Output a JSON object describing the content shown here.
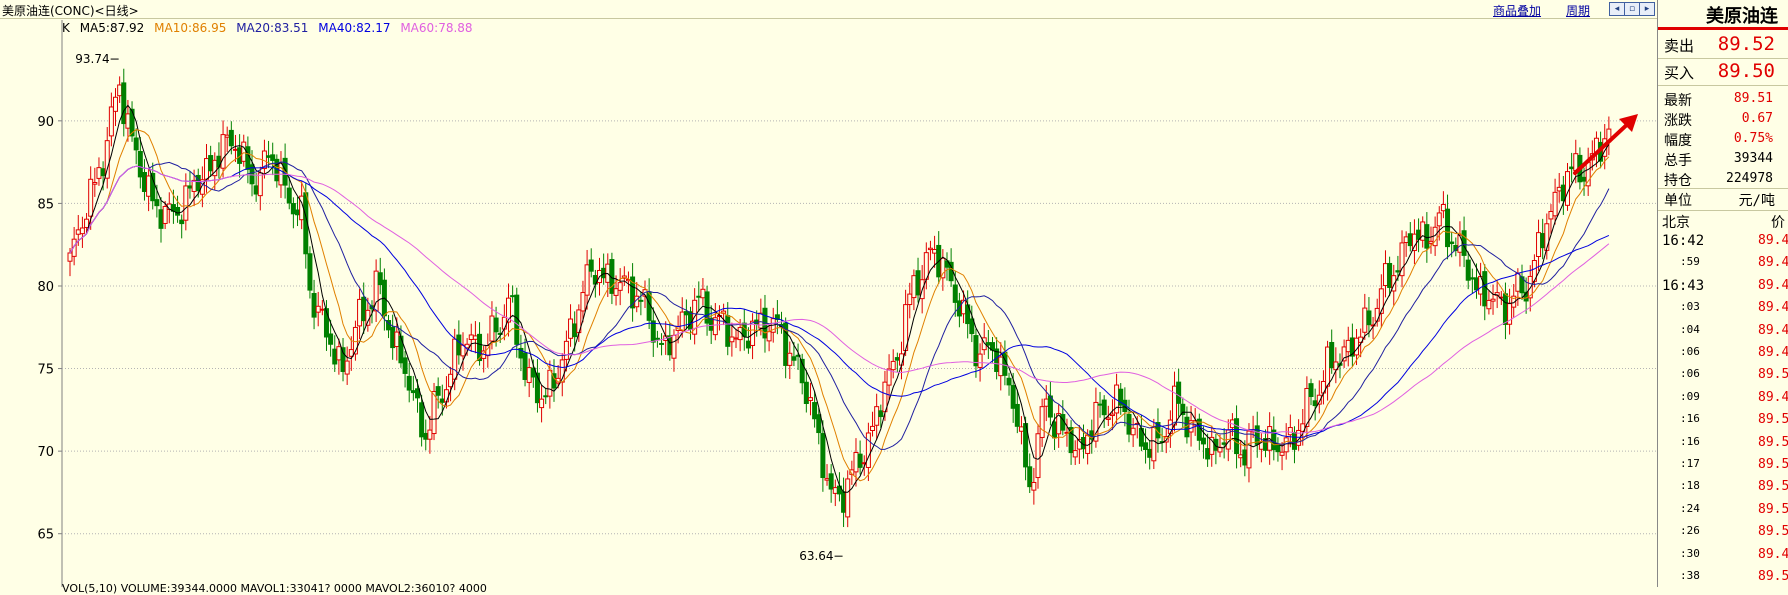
{
  "topbar": {
    "title": "美原油连(CONC)<日线>",
    "overlay_link": "商品叠加",
    "period_link": "周期"
  },
  "legend": {
    "k": "K",
    "ma5": "MA5:87.92",
    "ma10": "MA10:86.95",
    "ma20": "MA20:83.51",
    "ma40": "MA40:82.17",
    "ma60": "MA60:78.88"
  },
  "bottom_bar": "VOL(5,10) VOLUME:39344.0000 MAVOL1:33041? 0000 MAVOL2:36010? 4000",
  "colors": {
    "up": "#e00000",
    "down": "#008000",
    "ma5": "#000000",
    "ma10": "#e08000",
    "ma20": "#2020a0",
    "ma40": "#0000e0",
    "ma60": "#e060e0",
    "arrow": "#e00000"
  },
  "chart_data": {
    "type": "candlestick",
    "title": "美原油连(CONC)<日线>",
    "ylim": [
      62.5,
      95.5
    ],
    "y_ticks": [
      65,
      70,
      75,
      80,
      85,
      90
    ],
    "y_tick_labels": [
      "65",
      "70",
      "75",
      "80",
      "85",
      "90"
    ],
    "grid": true,
    "annotations": {
      "high": {
        "label": "93.74",
        "value": 93.74
      },
      "low": {
        "label": "63.64",
        "value": 63.64
      }
    },
    "keypoints": [
      [
        0,
        82
      ],
      [
        6,
        86
      ],
      [
        12,
        92
      ],
      [
        18,
        86
      ],
      [
        24,
        84
      ],
      [
        30,
        86
      ],
      [
        36,
        88
      ],
      [
        40,
        89
      ],
      [
        44,
        86
      ],
      [
        48,
        88
      ],
      [
        52,
        86
      ],
      [
        56,
        84
      ],
      [
        58,
        80
      ],
      [
        62,
        77
      ],
      [
        66,
        75
      ],
      [
        70,
        78
      ],
      [
        74,
        80
      ],
      [
        78,
        77
      ],
      [
        82,
        74
      ],
      [
        86,
        71
      ],
      [
        92,
        75
      ],
      [
        96,
        77
      ],
      [
        100,
        76
      ],
      [
        106,
        79
      ],
      [
        110,
        75
      ],
      [
        114,
        73
      ],
      [
        120,
        76
      ],
      [
        124,
        80
      ],
      [
        128,
        81
      ],
      [
        132,
        80
      ],
      [
        136,
        80
      ],
      [
        140,
        78
      ],
      [
        144,
        76
      ],
      [
        148,
        78
      ],
      [
        152,
        79
      ],
      [
        156,
        78
      ],
      [
        160,
        77
      ],
      [
        164,
        77
      ],
      [
        168,
        78
      ],
      [
        172,
        77
      ],
      [
        176,
        75
      ],
      [
        180,
        72
      ],
      [
        184,
        67
      ],
      [
        188,
        68
      ],
      [
        192,
        70
      ],
      [
        196,
        73
      ],
      [
        200,
        76
      ],
      [
        204,
        80
      ],
      [
        208,
        82
      ],
      [
        212,
        81
      ],
      [
        216,
        78
      ],
      [
        220,
        76
      ],
      [
        224,
        76
      ],
      [
        228,
        73
      ],
      [
        232,
        68
      ],
      [
        236,
        73
      ],
      [
        240,
        71
      ],
      [
        244,
        70
      ],
      [
        248,
        72
      ],
      [
        252,
        73
      ],
      [
        256,
        72
      ],
      [
        260,
        70
      ],
      [
        264,
        71
      ],
      [
        268,
        73
      ],
      [
        272,
        71
      ],
      [
        276,
        70
      ],
      [
        280,
        71
      ],
      [
        284,
        70
      ],
      [
        288,
        71
      ],
      [
        292,
        70
      ],
      [
        296,
        71
      ],
      [
        300,
        73
      ],
      [
        304,
        75
      ],
      [
        308,
        76
      ],
      [
        312,
        77
      ],
      [
        316,
        79
      ],
      [
        320,
        81
      ],
      [
        324,
        83
      ],
      [
        328,
        83
      ],
      [
        332,
        84
      ],
      [
        336,
        82
      ],
      [
        340,
        80
      ],
      [
        344,
        79
      ],
      [
        348,
        79
      ],
      [
        352,
        80
      ],
      [
        356,
        83
      ],
      [
        360,
        86
      ],
      [
        364,
        87
      ],
      [
        368,
        87.5
      ],
      [
        372,
        89.5
      ]
    ],
    "moving_averages": [
      {
        "name": "MA5",
        "period": 5,
        "value": 87.92
      },
      {
        "name": "MA10",
        "period": 10,
        "value": 86.95
      },
      {
        "name": "MA20",
        "period": 20,
        "value": 83.51
      },
      {
        "name": "MA40",
        "period": 40,
        "value": 82.17
      },
      {
        "name": "MA60",
        "period": 60,
        "value": 78.88
      }
    ]
  },
  "quote": {
    "name": "美原油连",
    "sell_label": "卖出",
    "sell_value": "89.52",
    "buy_label": "买入",
    "buy_value": "89.50",
    "rows": [
      {
        "label": "最新",
        "value": "89.51"
      },
      {
        "label": "涨跌",
        "value": "0.67"
      },
      {
        "label": "幅度",
        "value": "0.75%"
      },
      {
        "label": "总手",
        "value": "39344"
      },
      {
        "label": "持仓",
        "value": "224978"
      }
    ],
    "unit_label": "单位",
    "unit_value": "元/吨",
    "city_label": "北京",
    "price_label": "价",
    "ticks": [
      {
        "time": "16:42",
        "price": "89.4"
      },
      {
        "time": ":59",
        "price": "89.4"
      },
      {
        "time": "16:43",
        "price": "89.4"
      },
      {
        "time": ":03",
        "price": "89.4"
      },
      {
        "time": ":04",
        "price": "89.4"
      },
      {
        "time": ":06",
        "price": "89.4"
      },
      {
        "time": ":06",
        "price": "89.5"
      },
      {
        "time": ":09",
        "price": "89.4"
      },
      {
        "time": ":16",
        "price": "89.5"
      },
      {
        "time": ":16",
        "price": "89.5"
      },
      {
        "time": ":17",
        "price": "89.5"
      },
      {
        "time": ":18",
        "price": "89.5"
      },
      {
        "time": ":24",
        "price": "89.5"
      },
      {
        "time": ":26",
        "price": "89.5"
      },
      {
        "time": ":30",
        "price": "89.4"
      },
      {
        "time": ":38",
        "price": "89.5"
      }
    ]
  }
}
